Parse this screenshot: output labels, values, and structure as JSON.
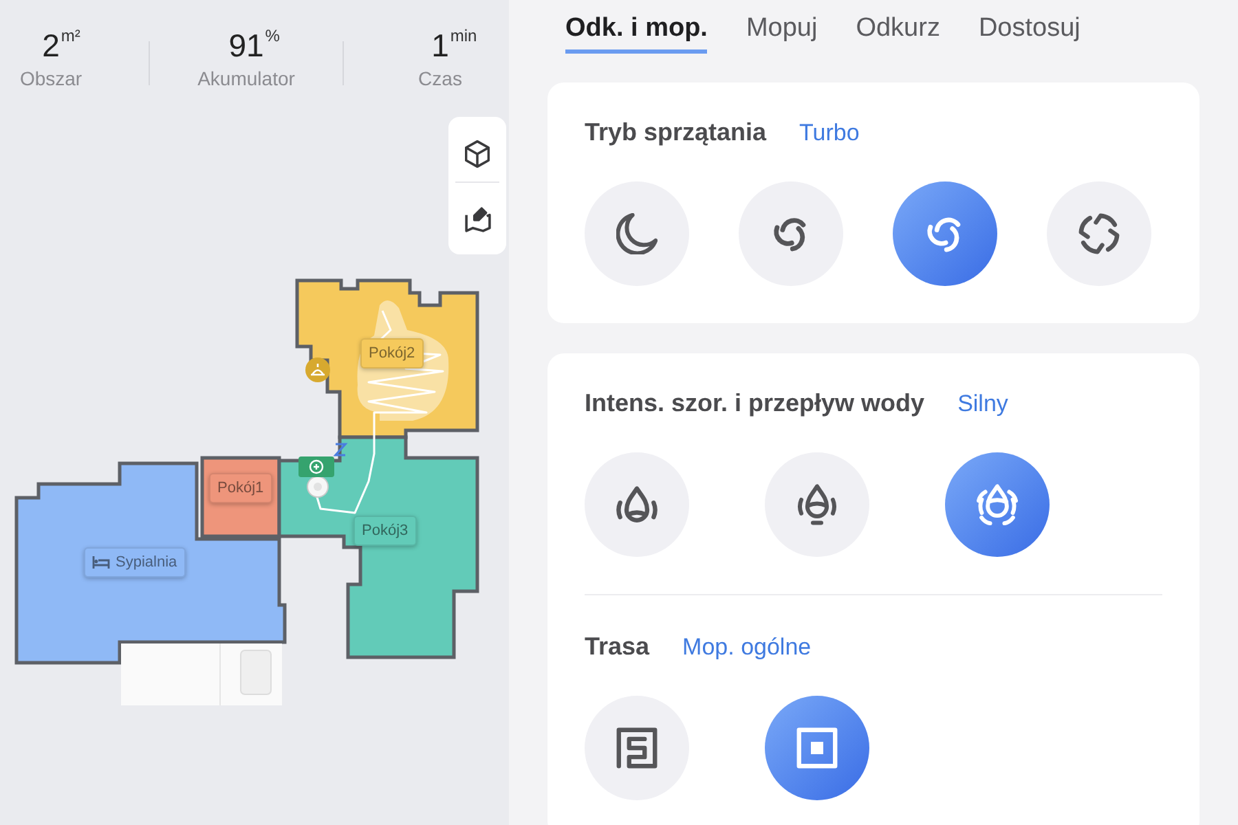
{
  "stats": [
    {
      "value": "2",
      "unit": "m²",
      "label": "Obszar"
    },
    {
      "value": "91",
      "unit": "%",
      "label": "Akumulator"
    },
    {
      "value": "1",
      "unit": "min",
      "label": "Czas"
    }
  ],
  "map": {
    "rooms": [
      {
        "name": "Pokój2",
        "kind": "room",
        "color": "#f5c95c"
      },
      {
        "name": "Pokój1",
        "kind": "room",
        "color": "#ee957b"
      },
      {
        "name": "Pokój3",
        "kind": "room",
        "color": "#62cbb8"
      },
      {
        "name": "Sypialnia",
        "kind": "bedroom",
        "color": "#8fb9f6"
      }
    ]
  },
  "tabs": [
    {
      "label": "Odk. i mop.",
      "selected": true
    },
    {
      "label": "Mopuj",
      "selected": false
    },
    {
      "label": "Odkurz",
      "selected": false
    },
    {
      "label": "Dostosuj",
      "selected": false
    }
  ],
  "cards": [
    {
      "sections": [
        {
          "title": "Tryb sprzątania",
          "value": "Turbo",
          "options": [
            {
              "kind": "quiet",
              "selected": false
            },
            {
              "kind": "standard",
              "selected": false
            },
            {
              "kind": "turbo",
              "selected": true
            },
            {
              "kind": "max",
              "selected": false
            }
          ]
        }
      ]
    },
    {
      "sections": [
        {
          "title": "Intens. szor. i przepływ wody",
          "value": "Silny",
          "options": [
            {
              "kind": "water_low",
              "selected": false
            },
            {
              "kind": "water_medium",
              "selected": false
            },
            {
              "kind": "water_high",
              "selected": true
            }
          ]
        },
        {
          "title": "Trasa",
          "value": "Mop. ogólne",
          "options": [
            {
              "kind": "route_deep",
              "selected": false
            },
            {
              "kind": "route_standard",
              "selected": true
            }
          ]
        }
      ]
    }
  ]
}
